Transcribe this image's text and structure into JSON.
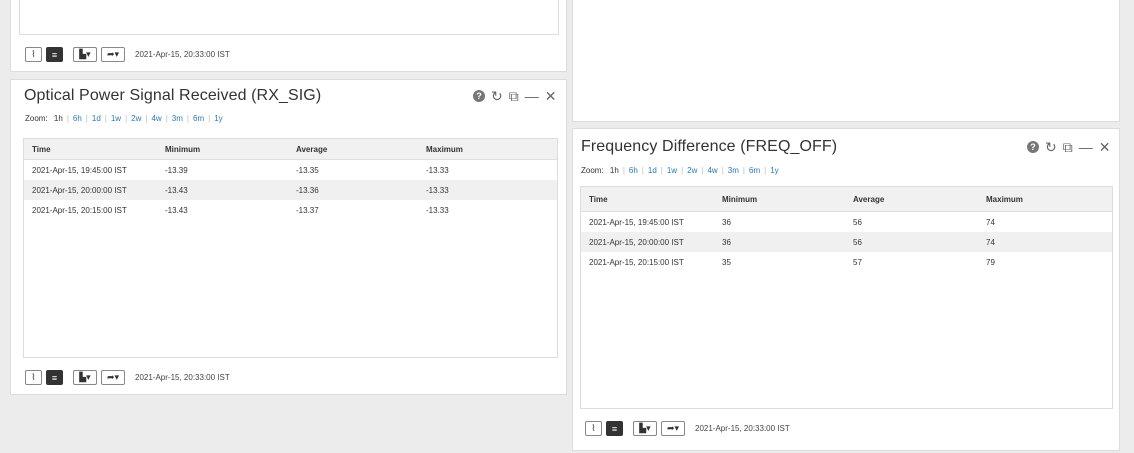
{
  "zoom_label": "Zoom:",
  "zoom_options": [
    "1h",
    "6h",
    "1d",
    "1w",
    "2w",
    "4w",
    "3m",
    "6m",
    "1y"
  ],
  "table_headers": [
    "Time",
    "Minimum",
    "Average",
    "Maximum"
  ],
  "icons": {
    "help": "?",
    "refresh": "↻",
    "popout": "⧉",
    "minimize": "—",
    "close": "✕",
    "line_chart": "⌇",
    "table_view": "≡",
    "chart_type": "▙▾",
    "share": "➦▾"
  },
  "top_panel": {
    "timestamp": "2021-Apr-15, 20:33:00 IST"
  },
  "rx_panel": {
    "title": "Optical Power Signal Received (RX_SIG)",
    "rows": [
      [
        "2021-Apr-15, 19:45:00 IST",
        "-13.39",
        "-13.35",
        "-13.33"
      ],
      [
        "2021-Apr-15, 20:00:00 IST",
        "-13.43",
        "-13.36",
        "-13.33"
      ],
      [
        "2021-Apr-15, 20:15:00 IST",
        "-13.43",
        "-13.37",
        "-13.33"
      ]
    ],
    "timestamp": "2021-Apr-15, 20:33:00 IST"
  },
  "freq_panel": {
    "title": "Frequency Difference (FREQ_OFF)",
    "rows": [
      [
        "2021-Apr-15, 19:45:00 IST",
        "36",
        "56",
        "74"
      ],
      [
        "2021-Apr-15, 20:00:00 IST",
        "36",
        "56",
        "74"
      ],
      [
        "2021-Apr-15, 20:15:00 IST",
        "35",
        "57",
        "79"
      ]
    ],
    "timestamp": "2021-Apr-15, 20:33:00 IST"
  },
  "colors": {
    "link": "#2a7ab8",
    "background": "#ececec",
    "panel": "#ffffff",
    "alt_row": "#f0f0f0"
  }
}
